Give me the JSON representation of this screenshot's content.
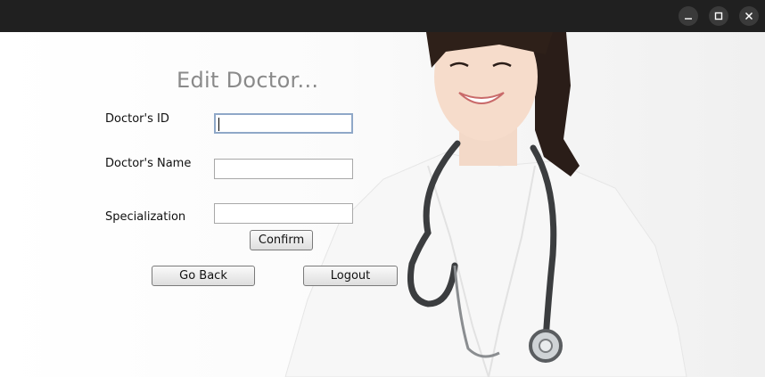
{
  "window": {
    "controls": {
      "minimize_icon": "minimize-icon",
      "maximize_icon": "maximize-icon",
      "close_icon": "close-icon"
    },
    "titlebar_color": "#202020"
  },
  "form": {
    "title": "Edit Doctor...",
    "fields": {
      "id_label": "Doctor's ID",
      "id_value": "",
      "name_label": "Doctor's Name",
      "name_value": "",
      "spec_label": "Specialization",
      "spec_value": ""
    },
    "buttons": {
      "confirm": "Confirm",
      "go_back": "Go Back",
      "logout": "Logout"
    }
  },
  "background": {
    "image": "doctor-with-stethoscope"
  }
}
